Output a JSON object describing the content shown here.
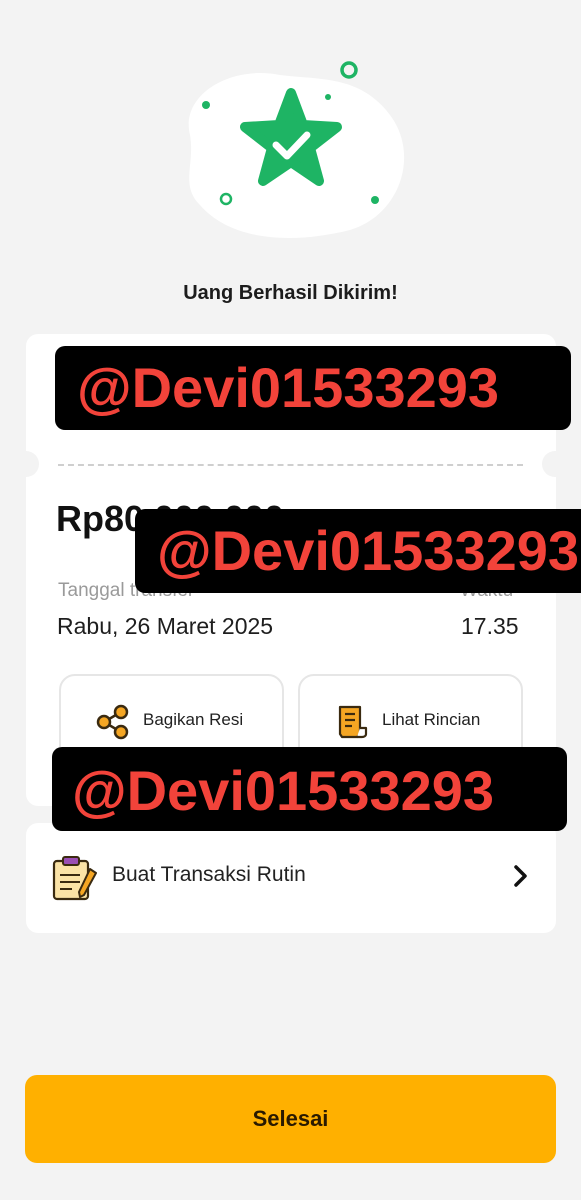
{
  "header": {
    "title": "Uang Berhasil Dikirim!",
    "hero_icon": "star-check-icon",
    "hero_color": "#1eb464"
  },
  "receipt": {
    "amount": "Rp80.000.000",
    "date_label": "Tanggal transfer",
    "date_value": "Rabu, 26 Maret 2025",
    "time_label": "Waktu",
    "time_value": "17.35"
  },
  "actions": {
    "share_label": "Bagikan Resi",
    "share_icon": "share-icon",
    "details_label": "Lihat Rincian",
    "details_icon": "receipt-icon"
  },
  "routine": {
    "label": "Buat Transaksi Rutin",
    "icon": "clipboard-icon"
  },
  "footer": {
    "done_label": "Selesai",
    "done_color": "#ffb000"
  },
  "watermarks": [
    "@Devi01533293",
    "@Devi01533293",
    "@Devi01533293"
  ]
}
